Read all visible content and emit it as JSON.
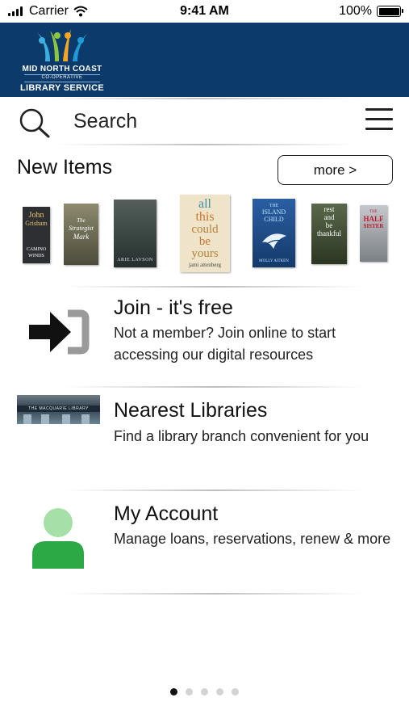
{
  "status_bar": {
    "carrier": "Carrier",
    "time": "9:41 AM",
    "battery": "100%"
  },
  "header": {
    "logo_line1": "MID NORTH COAST",
    "logo_line2": "CO-OPERATIVE",
    "logo_line3": "LIBRARY SERVICE",
    "background": "#0b3a6b"
  },
  "search": {
    "label": "Search",
    "icon": "search-icon",
    "menu_icon": "hamburger-menu-icon"
  },
  "new_items": {
    "title": "New Items",
    "more_label": "more >",
    "books": [
      {
        "lines": [
          "John",
          "Grisham",
          "",
          "CAMINO",
          "WINDS"
        ],
        "color": "#2d2f33"
      },
      {
        "lines": [
          "",
          "The",
          "Strategist",
          "Mark"
        ],
        "color": "#6b6a55"
      },
      {
        "lines": [
          "",
          "",
          "",
          "",
          "ARIE LAVSON"
        ],
        "color": "#3a4444"
      },
      {
        "lines": [
          "all",
          "this",
          "could",
          "be",
          "yours",
          "jami attenberg"
        ],
        "color": "#efe4c9"
      },
      {
        "lines": [
          "THE",
          "ISLAND",
          "CHILD",
          "",
          "MOLLY AITKEN"
        ],
        "color": "#1f4f8c"
      },
      {
        "lines": [
          "rest",
          "and",
          "be",
          "thankful"
        ],
        "color": "#3e4a33"
      },
      {
        "lines": [
          "THE",
          "HALF",
          "SISTER"
        ],
        "color": "#9a9ea3"
      }
    ]
  },
  "join": {
    "title": "Join - it's free",
    "description": "Not a member? Join online to start accessing our digital resources"
  },
  "nearest": {
    "title": "Nearest Libraries",
    "description": "Find a library branch convenient for you",
    "photo_sign": "THE MACQUARIE LIBRARY"
  },
  "account": {
    "title": "My Account",
    "description": "Manage loans, reservations, renew & more"
  },
  "pager": {
    "pages": 5,
    "active": 1
  },
  "colors": {
    "account_icon_head": "#a6dfa8",
    "account_icon_body": "#2ca844",
    "join_icon_dark": "#111111",
    "join_icon_gray": "#9a9a9a"
  }
}
